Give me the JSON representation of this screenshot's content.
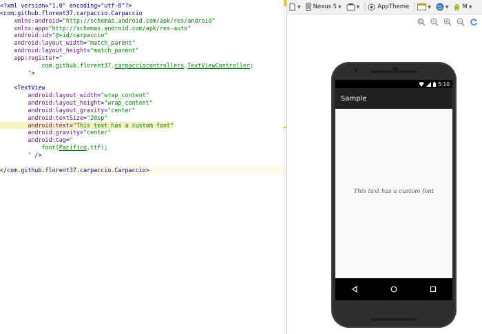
{
  "editor": {
    "lines": [
      [
        {
          "c": "t-decl",
          "t": "<?xml version=\"1.0\" encoding=\"utf-8\"?>"
        }
      ],
      [
        {
          "c": "t-tag",
          "t": "<com.github.florent37.carpaccio.Carpaccio"
        }
      ],
      [
        {
          "c": "t-attr",
          "t": "    xmlns:android"
        },
        {
          "c": "t-eq",
          "t": "="
        },
        {
          "c": "t-str",
          "t": "\"http://schemas.android.com/apk/res/android\""
        }
      ],
      [
        {
          "c": "t-attr",
          "t": "    xmlns:app"
        },
        {
          "c": "t-eq",
          "t": "="
        },
        {
          "c": "t-str",
          "t": "\"http://schemas.android.com/apk/res-auto\""
        }
      ],
      [
        {
          "c": "t-attr",
          "t": "    android:id"
        },
        {
          "c": "t-eq",
          "t": "="
        },
        {
          "c": "t-str",
          "t": "\"@+id/carpaccio\""
        }
      ],
      [
        {
          "c": "t-attr",
          "t": "    android:layout_width"
        },
        {
          "c": "t-eq",
          "t": "="
        },
        {
          "c": "t-str",
          "t": "\"match_parent\""
        }
      ],
      [
        {
          "c": "t-attr",
          "t": "    android:layout_height"
        },
        {
          "c": "t-eq",
          "t": "="
        },
        {
          "c": "t-str",
          "t": "\"match_parent\""
        }
      ],
      [
        {
          "c": "t-attr",
          "t": "    app:register"
        },
        {
          "c": "t-eq",
          "t": "="
        },
        {
          "c": "t-str",
          "t": "\""
        }
      ],
      [
        {
          "c": "t-str",
          "t": "            com.github.florent37."
        },
        {
          "c": "t-str t-ref",
          "t": "carpacciocontrollers"
        },
        {
          "c": "t-str",
          "t": "."
        },
        {
          "c": "t-str t-ref",
          "t": "TextViewController"
        },
        {
          "c": "t-str",
          "t": ";"
        }
      ],
      [
        {
          "c": "t-str",
          "t": "        \""
        },
        {
          "c": "t-tag",
          "t": ">"
        }
      ],
      [],
      [
        {
          "c": "t-tag",
          "t": "    <TextView"
        }
      ],
      [
        {
          "c": "t-attr",
          "t": "        android:layout_width"
        },
        {
          "c": "t-eq",
          "t": "="
        },
        {
          "c": "t-str",
          "t": "\"wrap_content\""
        }
      ],
      [
        {
          "c": "t-attr",
          "t": "        android:layout_height"
        },
        {
          "c": "t-eq",
          "t": "="
        },
        {
          "c": "t-str",
          "t": "\"wrap_content\""
        }
      ],
      [
        {
          "c": "t-attr",
          "t": "        android:layout_gravity"
        },
        {
          "c": "t-eq",
          "t": "="
        },
        {
          "c": "t-str",
          "t": "\"center\""
        }
      ],
      [
        {
          "c": "t-attr",
          "t": "        android:textSize"
        },
        {
          "c": "t-eq",
          "t": "="
        },
        {
          "c": "t-str",
          "t": "\"20sp\""
        }
      ],
      [
        {
          "c": "t-attr t-hl",
          "t": "        android:text"
        },
        {
          "c": "t-eq t-hl",
          "t": "="
        },
        {
          "c": "t-str t-hl",
          "t": "\"This text has a custom font\""
        }
      ],
      [
        {
          "c": "t-attr",
          "t": "        android:gravity"
        },
        {
          "c": "t-eq",
          "t": "="
        },
        {
          "c": "t-str",
          "t": "\"center\""
        }
      ],
      [
        {
          "c": "t-attr",
          "t": "        android:tag"
        },
        {
          "c": "t-eq",
          "t": "="
        },
        {
          "c": "t-str",
          "t": "\""
        }
      ],
      [
        {
          "c": "t-str",
          "t": "            font("
        },
        {
          "c": "t-str t-ref",
          "t": "Pacifico"
        },
        {
          "c": "t-str",
          "t": ".ttf);"
        }
      ],
      [
        {
          "c": "t-str",
          "t": "        \""
        },
        {
          "c": "t-tag",
          "t": " />"
        }
      ],
      [],
      [
        {
          "c": "t-tag",
          "t": "</com.github.florent37.carpaccio.Carpaccio>"
        }
      ]
    ],
    "caret_line": 22
  },
  "toolbar": {
    "device_label": "Nexus 5",
    "theme_label": "AppTheme",
    "api_label": "M"
  },
  "phone": {
    "status_time": "5:10",
    "app_title": "Sample",
    "content_text": "This text has a custom font"
  },
  "colors": {
    "action_bar": "#212121",
    "content_bg": "#fafafa",
    "android_green": "#97c024"
  }
}
